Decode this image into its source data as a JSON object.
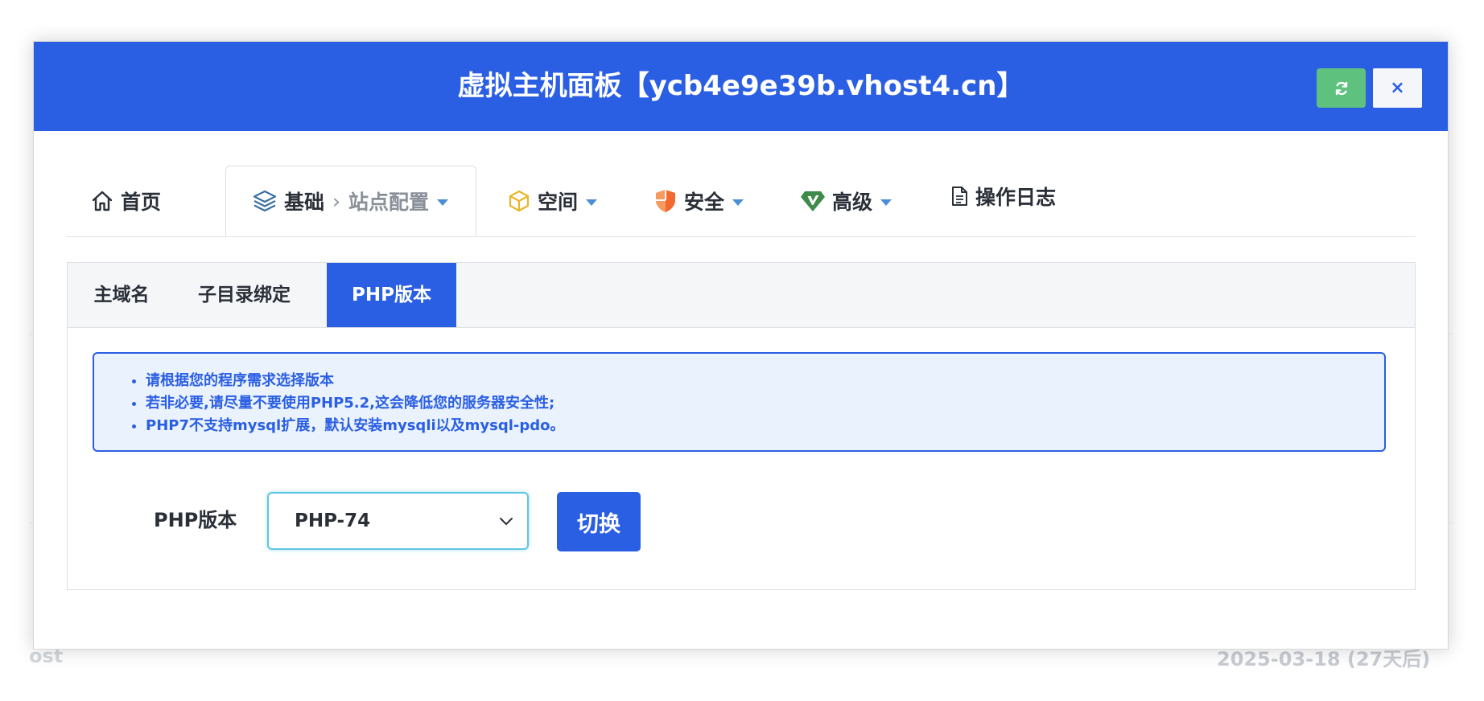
{
  "modal": {
    "title": "虚拟主机面板【ycb4e9e39b.vhost4.cn】",
    "refresh_icon": "refresh-icon",
    "close_label": "×"
  },
  "nav": {
    "home": "首页",
    "basic": "基础",
    "basic_sub": "站点配置",
    "space": "空间",
    "security": "安全",
    "advanced": "高级",
    "log": "操作日志"
  },
  "subtabs": {
    "main_domain": "主域名",
    "subdir_bind": "子目录绑定",
    "php_version": "PHP版本"
  },
  "notice": [
    "请根据您的程序需求选择版本",
    "若非必要,请尽量不要使用PHP5.2,这会降低您的服务器安全性;",
    "PHP7不支持mysql扩展，默认安装mysqli以及mysql-pdo。"
  ],
  "form": {
    "label": "PHP版本",
    "selected": "PHP-74",
    "submit": "切换"
  },
  "background": {
    "date": "2025-03-18 (27天后)",
    "row_text": "ost"
  },
  "colors": {
    "primary": "#2b5fe3",
    "success": "#5ec17d",
    "notice_bg": "#eaf2fd"
  }
}
